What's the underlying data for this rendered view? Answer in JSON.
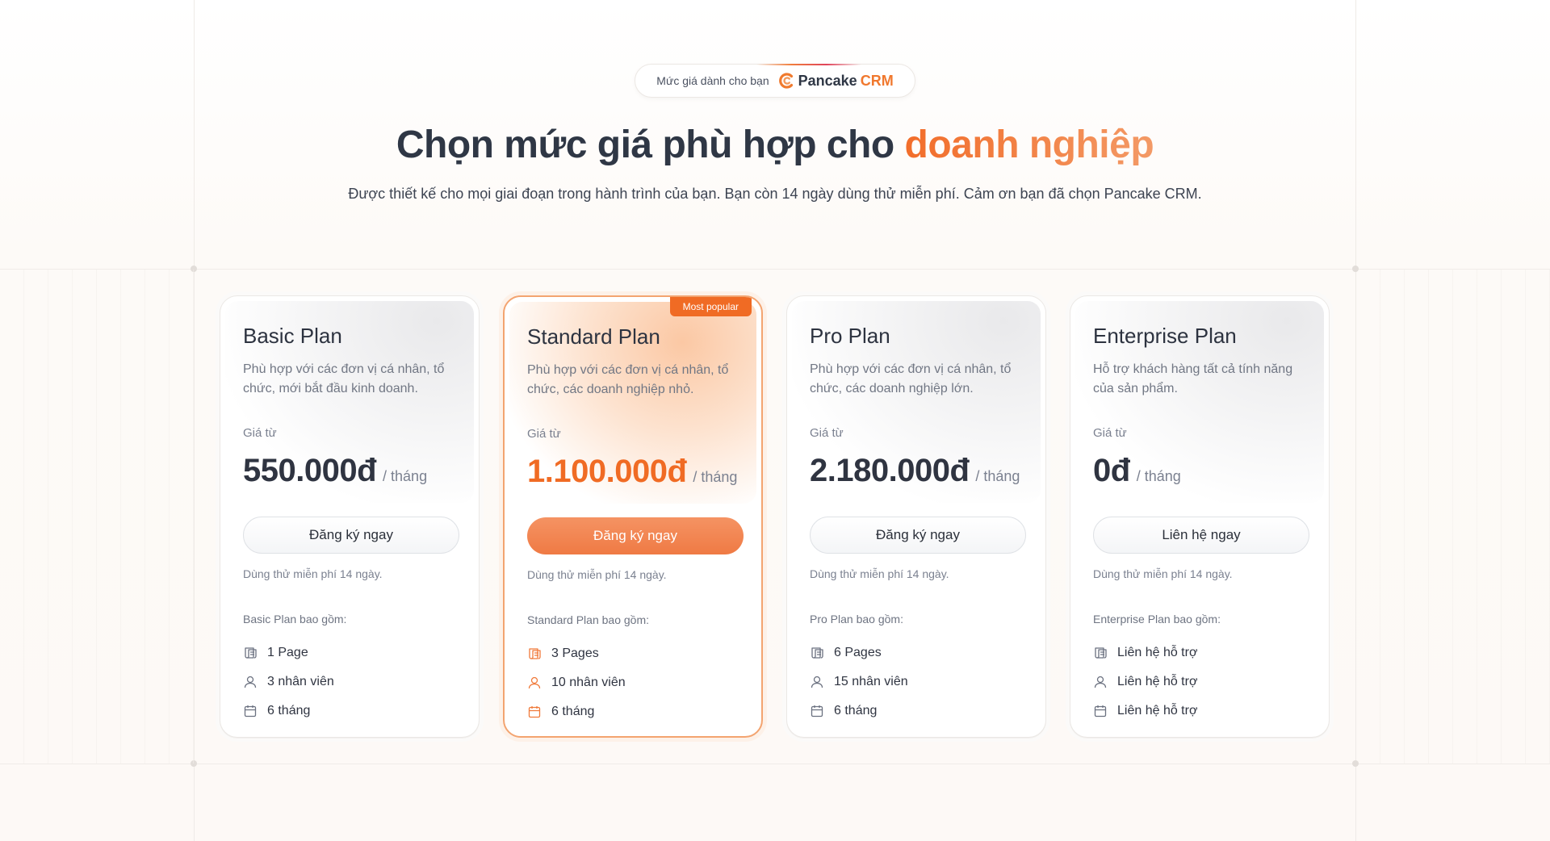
{
  "badge": {
    "text": "Mức giá dành cho bạn",
    "logo_name": "Pancake",
    "logo_suffix": "CRM"
  },
  "headline": {
    "main": "Chọn mức giá phù hợp cho ",
    "accent": "doanh nghiệp"
  },
  "subheadline": "Được thiết kế cho mọi giai đoạn trong hành trình của bạn. Bạn còn 14 ngày dùng thử miễn phí. Cảm ơn bạn đã chọn Pancake CRM.",
  "colors": {
    "accent": "#f06b24",
    "text": "#2f3745",
    "muted": "#7b8190"
  },
  "plans": [
    {
      "name": "Basic Plan",
      "description": "Phù hợp với các đơn vị cá nhân, tổ chức, mới bắt đầu kinh doanh.",
      "price_label": "Giá từ",
      "price": "550.000đ",
      "period": "/ tháng",
      "button": "Đăng ký ngay",
      "trial": "Dùng thử miễn phí 14 ngày.",
      "includes": "Basic Plan bao gồm:",
      "features": [
        {
          "icon": "pages-icon",
          "text": "1 Page"
        },
        {
          "icon": "user-icon",
          "text": "3 nhân viên"
        },
        {
          "icon": "calendar-icon",
          "text": "6 tháng"
        }
      ]
    },
    {
      "name": "Standard Plan",
      "badge": "Most popular",
      "description": "Phù hợp với các đơn vị cá nhân, tổ chức, các doanh nghiệp nhỏ.",
      "price_label": "Giá từ",
      "price": "1.100.000đ",
      "period": "/ tháng",
      "button": "Đăng ký ngay",
      "trial": "Dùng thử miễn phí 14 ngày.",
      "includes": "Standard Plan bao gồm:",
      "features": [
        {
          "icon": "pages-icon",
          "text": "3 Pages"
        },
        {
          "icon": "user-icon",
          "text": "10 nhân viên"
        },
        {
          "icon": "calendar-icon",
          "text": "6 tháng"
        }
      ]
    },
    {
      "name": "Pro Plan",
      "description": "Phù hợp với các đơn vị cá nhân, tổ chức, các doanh nghiệp lớn.",
      "price_label": "Giá từ",
      "price": "2.180.000đ",
      "period": "/ tháng",
      "button": "Đăng ký ngay",
      "trial": "Dùng thử miễn phí 14 ngày.",
      "includes": "Pro Plan bao gồm:",
      "features": [
        {
          "icon": "pages-icon",
          "text": "6 Pages"
        },
        {
          "icon": "user-icon",
          "text": "15 nhân viên"
        },
        {
          "icon": "calendar-icon",
          "text": "6 tháng"
        }
      ]
    },
    {
      "name": "Enterprise Plan",
      "description": "Hỗ trợ khách hàng tất cả tính năng của sản phẩm.",
      "price_label": "Giá từ",
      "price": "0đ",
      "period": "/ tháng",
      "button": "Liên hệ ngay",
      "trial": "Dùng thử miễn phí 14 ngày.",
      "includes": "Enterprise Plan bao gồm:",
      "features": [
        {
          "icon": "pages-icon",
          "text": "Liên hệ hỗ trợ"
        },
        {
          "icon": "user-icon",
          "text": "Liên hệ hỗ trợ"
        },
        {
          "icon": "calendar-icon",
          "text": "Liên hệ hỗ trợ"
        }
      ]
    }
  ]
}
